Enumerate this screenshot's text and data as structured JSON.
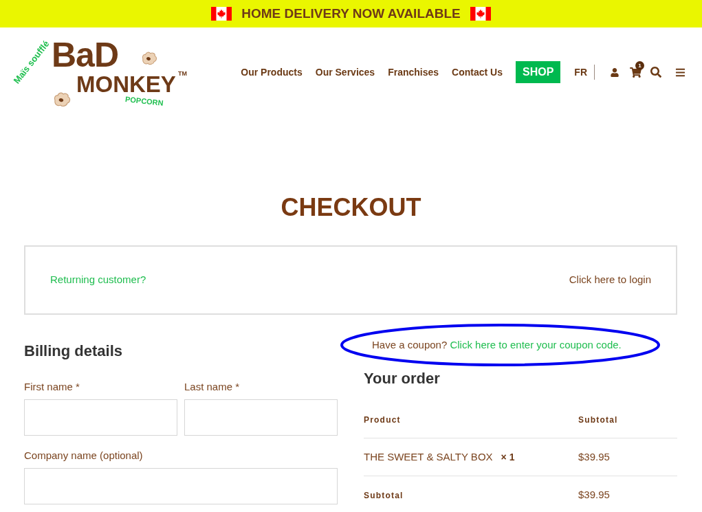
{
  "announcement_bar": {
    "text": "HOME DELIVERY NOW AVAILABLE"
  },
  "header": {
    "logo": {
      "tagline": "Maïs soufflé",
      "wordmark_top": "BaD",
      "wordmark_bottom": "MONKEY",
      "trademark": "TM",
      "subtitle": "POPCORN"
    },
    "nav": [
      "Our Products",
      "Our Services",
      "Franchises",
      "Contact Us"
    ],
    "shop_button": "SHOP",
    "language": "FR",
    "cart_count": "1"
  },
  "page_title": "CHECKOUT",
  "login_notice": {
    "prompt": "Returning customer?",
    "link": "Click here to login"
  },
  "billing": {
    "title": "Billing details",
    "fields": [
      {
        "kind": "half",
        "label": "First name *"
      },
      {
        "kind": "half",
        "label": "Last name *"
      },
      {
        "kind": "full",
        "label": "Company name (optional)"
      }
    ]
  },
  "coupon_notice": {
    "text": "Have a coupon?",
    "link": "Click here to enter your coupon code.",
    "circled": true
  },
  "order": {
    "title": "Your order",
    "columns": [
      "Product",
      "Subtotal"
    ],
    "rows": [
      {
        "kind": "item",
        "product": "THE SWEET & SALTY BOX",
        "quantity": "× 1",
        "subtotal": "$39.95"
      },
      {
        "kind": "total",
        "label": "Subtotal",
        "value": "$39.95"
      }
    ]
  }
}
